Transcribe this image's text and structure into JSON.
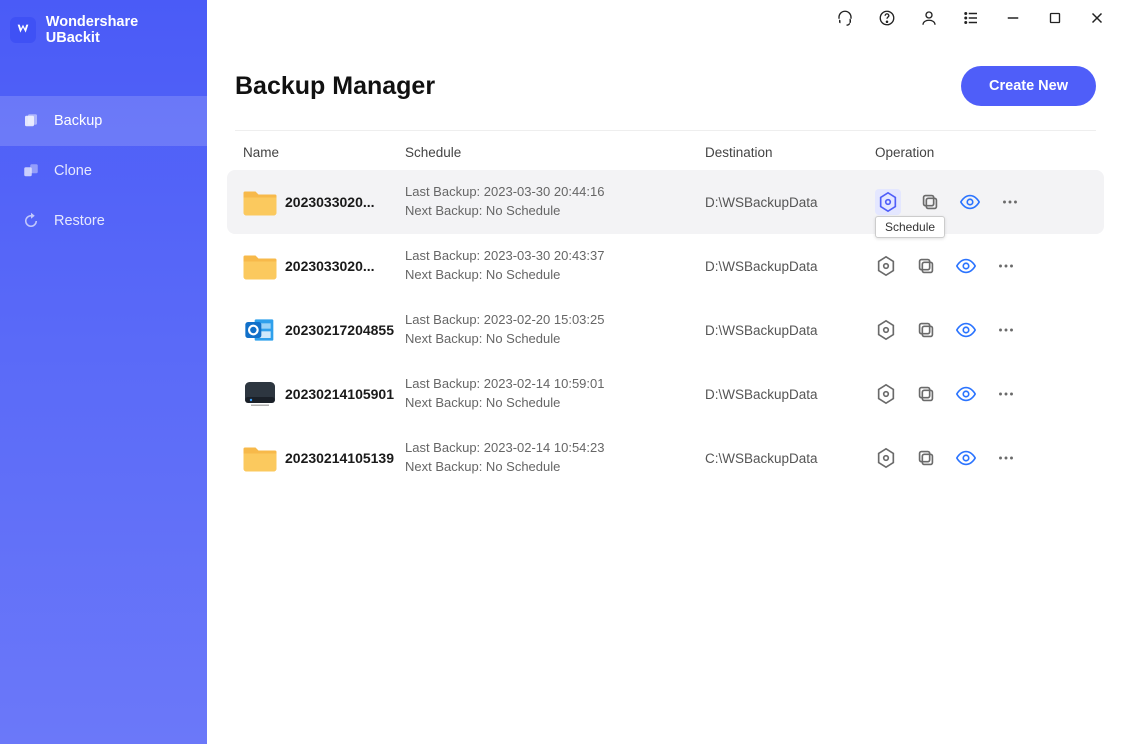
{
  "app_name": "Wondershare UBackit",
  "sidebar": {
    "items": [
      {
        "label": "Backup",
        "icon": "backup-icon",
        "active": true
      },
      {
        "label": "Clone",
        "icon": "clone-icon",
        "active": false
      },
      {
        "label": "Restore",
        "icon": "restore-icon",
        "active": false
      }
    ]
  },
  "header": {
    "title": "Backup Manager",
    "create_label": "Create New"
  },
  "columns": {
    "name": "Name",
    "schedule": "Schedule",
    "destination": "Destination",
    "operation": "Operation"
  },
  "tooltip": "Schedule",
  "rows": [
    {
      "name": "2023033020...",
      "icon": "folder",
      "last": "Last Backup: 2023-03-30 20:44:16",
      "next": "Next Backup: No Schedule",
      "dest": "D:\\WSBackupData",
      "highlight": true,
      "hex_active": true
    },
    {
      "name": "2023033020...",
      "icon": "folder",
      "last": "Last Backup: 2023-03-30 20:43:37",
      "next": "Next Backup: No Schedule",
      "dest": "D:\\WSBackupData",
      "highlight": false,
      "hex_active": false
    },
    {
      "name": "20230217204855",
      "icon": "outlook",
      "last": "Last Backup: 2023-02-20 15:03:25",
      "next": "Next Backup: No Schedule",
      "dest": "D:\\WSBackupData",
      "highlight": false,
      "hex_active": false
    },
    {
      "name": "20230214105901",
      "icon": "disk",
      "last": "Last Backup: 2023-02-14 10:59:01",
      "next": "Next Backup: No Schedule",
      "dest": "D:\\WSBackupData",
      "highlight": false,
      "hex_active": false
    },
    {
      "name": "20230214105139",
      "icon": "folder",
      "last": "Last Backup: 2023-02-14 10:54:23",
      "next": "Next Backup: No Schedule",
      "dest": "C:\\WSBackupData",
      "highlight": false,
      "hex_active": false
    }
  ]
}
